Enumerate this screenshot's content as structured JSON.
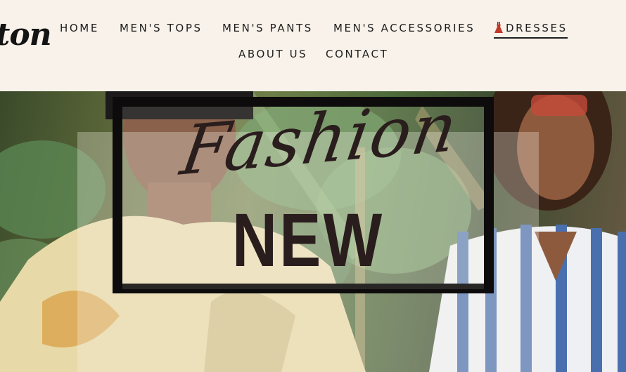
{
  "brand": {
    "logo_text": "ton"
  },
  "nav": {
    "row1": [
      {
        "label": "HOME",
        "active": false
      },
      {
        "label": "MEN'S TOPS",
        "active": false
      },
      {
        "label": "MEN'S PANTS",
        "active": false
      },
      {
        "label": "MEN'S ACCESSORIES",
        "active": false
      },
      {
        "label": "DRESSES",
        "active": true,
        "icon": "dress-icon"
      }
    ],
    "row2": [
      {
        "label": "ABOUT US",
        "active": false
      },
      {
        "label": "CONTACT",
        "active": false
      }
    ]
  },
  "hero": {
    "script_text": "Fashion",
    "headline": "NEW"
  },
  "colors": {
    "header_bg": "#f8f2ea",
    "nav_text": "#1e1e1e",
    "headline_text": "#2a1d1d",
    "dress_icon": "#c0392b"
  }
}
